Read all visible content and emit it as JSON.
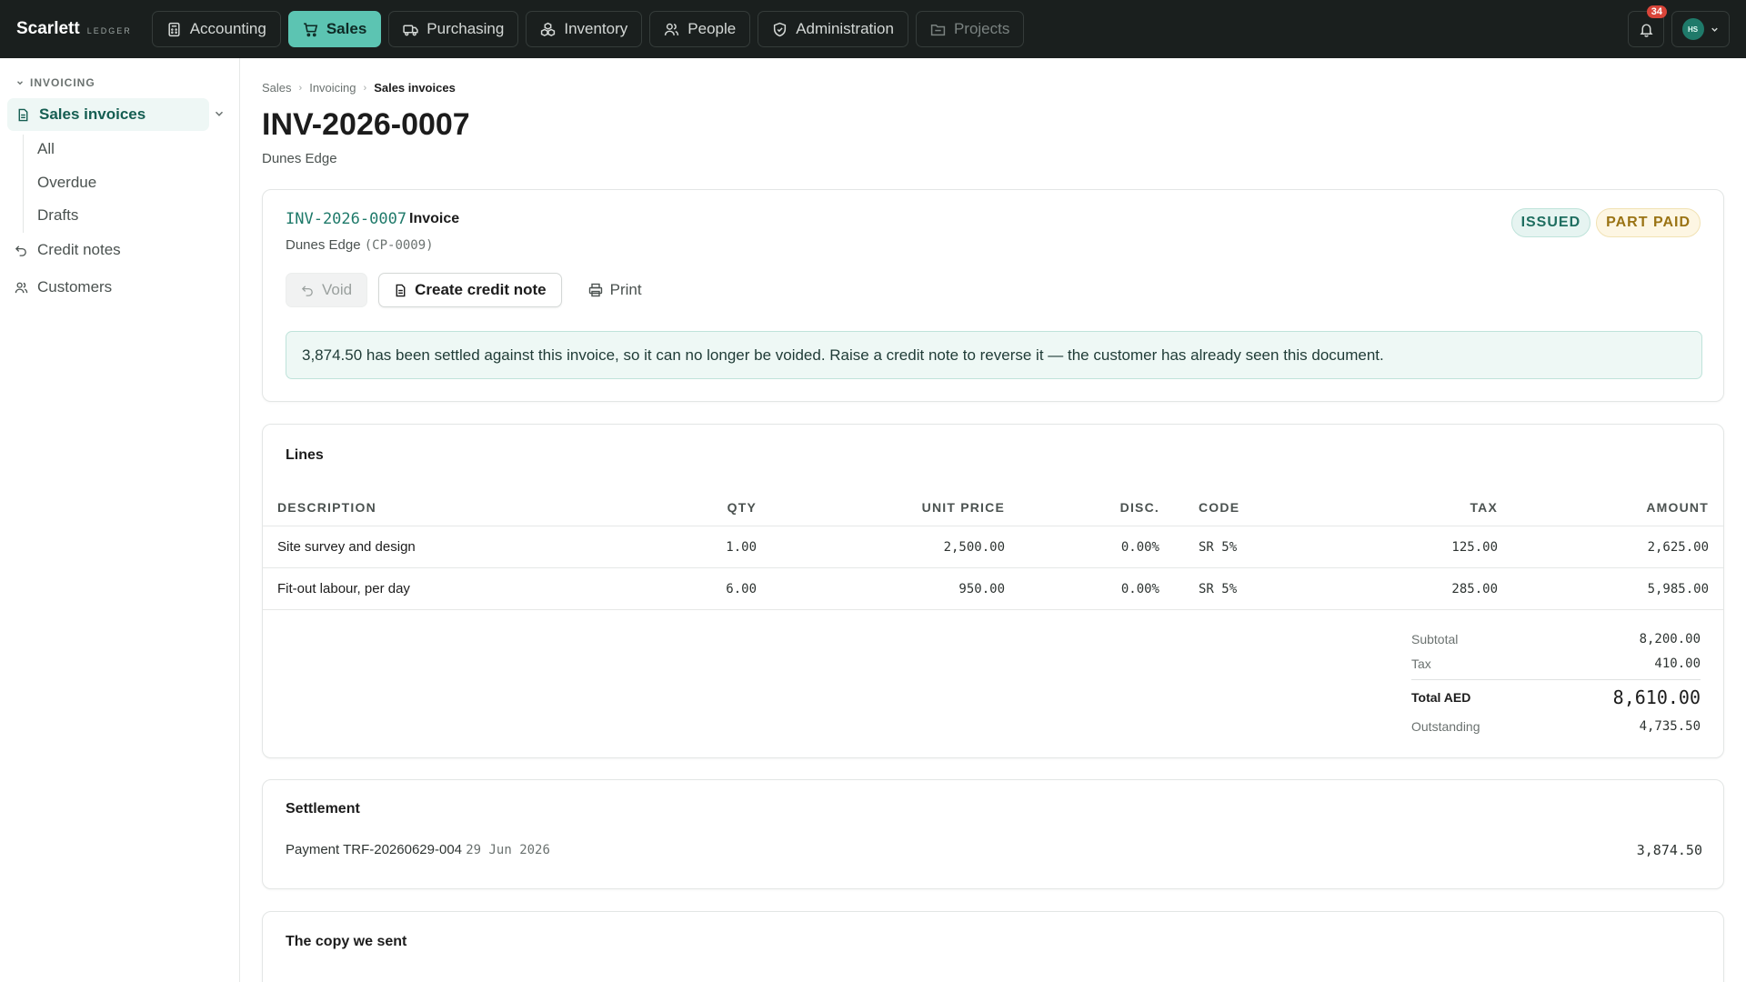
{
  "app": {
    "name": "Scarlett",
    "sub": "LEDGER"
  },
  "nav": [
    {
      "label": "Accounting",
      "icon": "calculator-icon",
      "state": "normal"
    },
    {
      "label": "Sales",
      "icon": "cart-icon",
      "state": "active"
    },
    {
      "label": "Purchasing",
      "icon": "truck-icon",
      "state": "normal"
    },
    {
      "label": "Inventory",
      "icon": "boxes-icon",
      "state": "normal"
    },
    {
      "label": "People",
      "icon": "people-icon",
      "state": "normal"
    },
    {
      "label": "Administration",
      "icon": "shield-icon",
      "state": "normal"
    },
    {
      "label": "Projects",
      "icon": "folder-icon",
      "state": "disabled"
    }
  ],
  "notifications": {
    "count": "34"
  },
  "user": {
    "initials": "HS"
  },
  "sidebar": {
    "section": "INVOICING",
    "active": "Sales invoices",
    "sub": [
      "All",
      "Overdue",
      "Drafts"
    ],
    "items": [
      "Credit notes",
      "Customers"
    ]
  },
  "breadcrumb": [
    "Sales",
    "Invoicing",
    "Sales invoices"
  ],
  "page": {
    "title": "INV-2026-0007",
    "subtitle": "Dunes Edge"
  },
  "invoice": {
    "number": "INV-2026-0007",
    "type": "Invoice",
    "customer": "Dunes Edge",
    "customer_code": "(CP-0009)",
    "status": "ISSUED",
    "payment_status": "PART PAID",
    "actions": {
      "void": "Void",
      "credit": "Create credit note",
      "print": "Print"
    },
    "notice": "3,874.50 has been settled against this invoice, so it can no longer be voided. Raise a credit note to reverse it — the customer has already seen this document."
  },
  "lines": {
    "title": "Lines",
    "columns": [
      "DESCRIPTION",
      "QTY",
      "UNIT PRICE",
      "DISC.",
      "CODE",
      "TAX",
      "AMOUNT"
    ],
    "rows": [
      {
        "description": "Site survey and design",
        "qty": "1.00",
        "unit_price": "2,500.00",
        "disc": "0.00%",
        "code": "SR 5%",
        "tax": "125.00",
        "amount": "2,625.00"
      },
      {
        "description": "Fit-out labour, per day",
        "qty": "6.00",
        "unit_price": "950.00",
        "disc": "0.00%",
        "code": "SR 5%",
        "tax": "285.00",
        "amount": "5,985.00"
      }
    ],
    "totals": {
      "subtotal_label": "Subtotal",
      "subtotal": "8,200.00",
      "tax_label": "Tax",
      "tax": "410.00",
      "total_label": "Total AED",
      "total": "8,610.00",
      "outstanding_label": "Outstanding",
      "outstanding": "4,735.50"
    }
  },
  "settlement": {
    "title": "Settlement",
    "label": "Payment TRF-20260629-004",
    "date": "29 Jun 2026",
    "amount": "3,874.50"
  },
  "copy": {
    "title": "The copy we sent"
  },
  "colors": {
    "accent": "#5cc4b2",
    "topbar": "#1a1f1e",
    "link": "#1f7a6a",
    "warning": "#9a7314"
  }
}
